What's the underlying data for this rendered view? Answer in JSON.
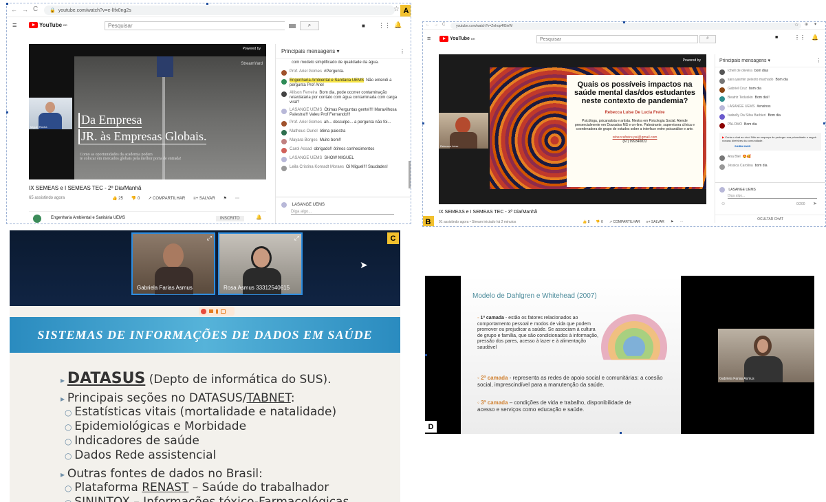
{
  "panel_a": {
    "label": "A",
    "url": "youtube.com/watch?v=e-lIfx0ng2s",
    "brand": "YouTube",
    "brand_sup": "BR",
    "search_placeholder": "Pesquisar",
    "powered_by": "Powered by",
    "streamyard": "StreamYard",
    "presenter_name": "Miguel Rocha",
    "slide_line1": "Da Empresa",
    "slide_line2": "JR. às Empresas Globais.",
    "slide_sub1": "Como as oportunidades da academia podem",
    "slide_sub2": "te colocar em mercados globais pela melhor porta de entrada!",
    "video_title": "IX SEMEAS e I SEMEAS TEC - 2º Dia/Manhã",
    "watching": "65 assistindo agora",
    "likes": "25",
    "dislikes": "0",
    "share": "COMPARTILHAR",
    "save": "SALVAR",
    "channel": "Engenharia Ambiental e Sanitária UEMS",
    "subscribed": "INSCRITO",
    "chat_header": "Principais mensagens",
    "chat_input_name": "LASANGE UEMS",
    "chat_input_placeholder": "Diga algo...",
    "messages": [
      {
        "name": "",
        "text": "com modelo simplificado de qualidade da água.",
        "color": "#ffffff"
      },
      {
        "name": "Prof. Ariel Gomes",
        "text": "#Pergunta.",
        "color": "#a0522d"
      },
      {
        "name": "Engenharia Ambiental e Sanitária UEMS",
        "text": "Não entendi a pergunta Prof Ariel",
        "color": "#2e8b57",
        "highlight": true
      },
      {
        "name": "Allison Ferreira",
        "text": "Bom dia, pode ocorrer contaminação retardatária por contato com água contaminada com carga viral?",
        "color": "#444444"
      },
      {
        "name": "LASANGE UEMS",
        "text": "Ótimas Perguntas gente!!!! Maravilhosa Palestra!!! Valeu Prof Fernando!!!",
        "color": "#b8b8d8"
      },
      {
        "name": "Prof. Ariel Gomes",
        "text": "ah... desculpe... a pergunta não foi...",
        "color": "#a0522d"
      },
      {
        "name": "Matheus Ouriel",
        "text": "ótima palestra",
        "color": "#2f6f4f"
      },
      {
        "name": "Mayara Borges",
        "text": "Muito bom!!",
        "color": "#c08080"
      },
      {
        "name": "Carol Assad",
        "text": "obrigado!! ótimos conhecimentos",
        "color": "#d0605a"
      },
      {
        "name": "LASANGE UEMS",
        "text": "SHOW MIGUEL",
        "color": "#b8b8d8"
      },
      {
        "name": "Leila Cristina Konradt Moraes",
        "text": "Oi Miguel!!! Saudades!",
        "color": "#999999"
      }
    ]
  },
  "panel_b": {
    "label": "B",
    "url": "youtube.com/watch?v=Zehop4fGieW",
    "brand": "YouTube",
    "brand_sup": "BR",
    "search_placeholder": "Pesquisar",
    "powered_by": "Powered by",
    "slide_title": "Quais os possíveis impactos na saúde mental das/dos estudantes neste contexto de pandemia?",
    "speaker": "Rebecca Luise De Lucia Freire",
    "bio": "Psicóloga, psicanalista e artista. Mestra em Psicologia Social. Atende presencialmente em Dourados MS e on-line. Palestrante, supervisora clínica e coordenadora de grupo de estudos sobre a interface entre psicanálise e arte.",
    "email": "rebeccafreire.psi@gmail.com",
    "phone": "(67) 999340822",
    "cam_name": "Rebecca Luise",
    "video_title": "IX SEMEAS e I SEMEAS TEC - 3º Dia/Manhã",
    "watching": "91 assistindo agora • Stream iniciado há 2 minutos",
    "likes": "8",
    "dislikes": "0",
    "share": "COMPARTILHAR",
    "save": "SALVAR",
    "chat_header": "Principais mensagens",
    "messages": [
      {
        "name": "Ichell de oliveira",
        "text": "bom dias",
        "color": "#555555"
      },
      {
        "name": "sara yasmin peixoto machado",
        "text": "Bom dia",
        "color": "#777777"
      },
      {
        "name": "Gabriel Cruz",
        "text": "bom dia",
        "color": "#8b4513"
      },
      {
        "name": "Beatriz Teduskin",
        "text": "Bom dia!!",
        "color": "#2f8f8f"
      },
      {
        "name": "LASANGE UEMS",
        "text": "#ensinos",
        "color": "#b8b8d8"
      },
      {
        "name": "Isabelly Da Silva Barbieri",
        "text": "Bom dia",
        "color": "#6a5acd"
      },
      {
        "name": "PALOMO",
        "text": "Bom dia",
        "color": "#8b0000"
      }
    ],
    "notice": "Curta o chat ao vivo! Não se esqueça de proteger sua privacidade e seguir nossas diretrizes da comunidade.",
    "notice_link": "SAIBA MAIS",
    "messages2": [
      {
        "name": "Ana Biel",
        "text": "😍🥰",
        "color": "#777777"
      },
      {
        "name": "Jéssica Carolina",
        "text": "bom dia",
        "color": "#999999"
      }
    ],
    "chat_input_name": "LASANGE UEMS",
    "chat_input_placeholder": "Diga algo...",
    "char_count": "0/200",
    "hide_chat": "OCULTAR CHAT"
  },
  "panel_c": {
    "label": "C",
    "participant1": "Gabriela Farias Asmus",
    "participant2": "Rosa Asmus 33312540615",
    "banner": "SISTEMAS DE INFORMAÇÕES DE DADOS EM SAÚDE",
    "b1_bold": "DATASUS",
    "b1_rest": " (Depto de informática do SUS).",
    "b2_pre": "Principais seções no DATASUS/",
    "b2_link": "TABNET",
    "b2_post": ":",
    "sub1": [
      "Estatísticas vitais (mortalidade e natalidade)",
      "Epidemiológicas e Morbidade",
      "Indicadores de saúde",
      "Dados Rede assistencial"
    ],
    "b3": "Outras fontes de dados no Brasil:",
    "sub2_1_pre": "Plataforma ",
    "sub2_1_link": "RENAST",
    "sub2_1_post": " – Saúde do trabalhador",
    "sub2_2": "SININTOX – Informações tóxico-Farmacológicas"
  },
  "panel_d": {
    "label": "D",
    "title": "Modelo de Dahlgren e Whitehead (2007)",
    "c1_bold": "1ª camada",
    "c1_text": " - estão os fatores relacionados ao comportamento pessoal e modos de vida que podem promover ou prejudicar a saúde. Se associam à cultura de grupo e família, que são condicionados à informação, pressão dos pares, acesso à lazer e à alimentação saudável",
    "c2_bold": "2ª camada",
    "c2_text": " - representa as redes de apoio social e comunitárias: a coesão social, imprescindível para a manutenção da saúde.",
    "c3_bold": "3ª camada",
    "c3_text": " – condições de vida e trabalho, disponibilidade de acesso e serviços como educação e saúde.",
    "cam_name": "Gabriela Farias Asmus"
  }
}
